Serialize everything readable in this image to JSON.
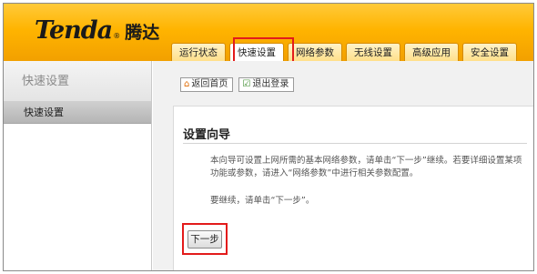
{
  "brand": {
    "wordmark": "Tenda",
    "reg": "®",
    "chinese": "腾达"
  },
  "nav": {
    "tabs": [
      {
        "label": "运行状态"
      },
      {
        "label": "快速设置"
      },
      {
        "label": "网络参数"
      },
      {
        "label": "无线设置"
      },
      {
        "label": "高级应用"
      },
      {
        "label": "安全设置"
      }
    ],
    "active_tab": "快速设置"
  },
  "sidebar": {
    "title": "快速设置",
    "items": [
      {
        "label": "快速设置"
      }
    ]
  },
  "toolbar": {
    "home_label": "返回首页",
    "logout_label": "退出登录"
  },
  "wizard": {
    "title": "设置向导",
    "description": "本向导可设置上网所需的基本网络参数，请单击“下一步”继续。若要详细设置某项功能或参数，请进入“网络参数”中进行相关参数配置。",
    "continue_text": "要继续，请单击“下一步”。",
    "next_label": "下一步"
  },
  "colors": {
    "header_orange": "#ffb400",
    "highlight_red": "#e31b1b"
  }
}
